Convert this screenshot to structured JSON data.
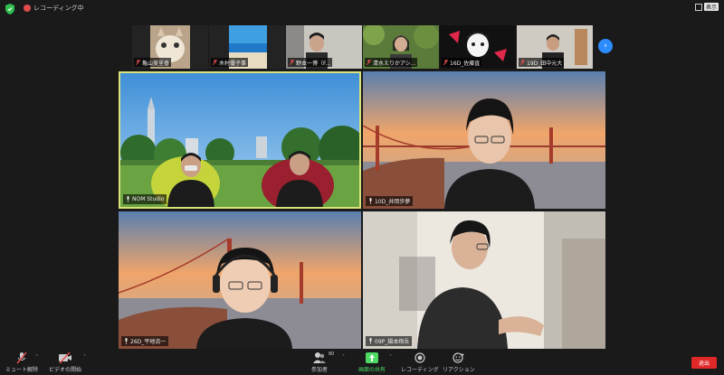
{
  "recording": {
    "label": "レコーディング中"
  },
  "view": {
    "label": "表示"
  },
  "thumbnails": [
    {
      "name": "亀山美里香"
    },
    {
      "name": "木村優子事"
    },
    {
      "name": "野本一博（F..."
    },
    {
      "name": "清水えりかアシ..."
    },
    {
      "name": "16D_佐藤直"
    },
    {
      "name": "19D_田中元大"
    }
  ],
  "tiles": [
    {
      "name": "NOM Studio"
    },
    {
      "name": "10D_井岡歩夢"
    },
    {
      "name": "26D_平地流一"
    },
    {
      "name": "09P_鍋本翔吾"
    }
  ],
  "toolbar": {
    "mute": "ミュート解除",
    "video": "ビデオの開始",
    "participants": "参加者",
    "participants_count": "80",
    "share": "画面の共有",
    "record": "レコーディング",
    "reaction": "リアクション",
    "exit": "退出"
  },
  "colors": {
    "share_green": "#4cd964",
    "exit_red": "#e02828",
    "active_border": "#d9e37a",
    "next_blue": "#2d8cff"
  }
}
